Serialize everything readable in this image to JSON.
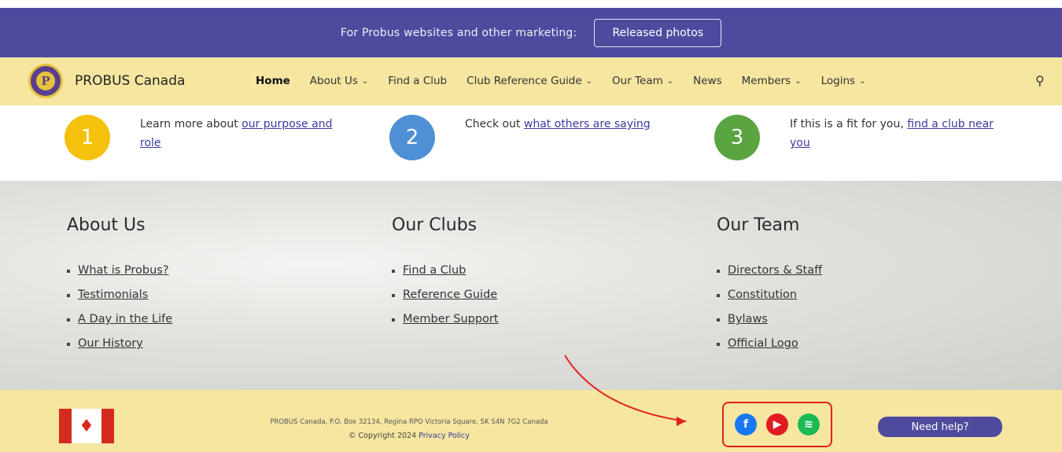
{
  "topbar": {
    "message": "For Probus websites and other marketing:",
    "button": "Released photos"
  },
  "brand": {
    "name": "PROBUS Canada",
    "logo_letter": "P"
  },
  "nav": [
    {
      "label": "Home",
      "active": true,
      "dropdown": false
    },
    {
      "label": "About Us",
      "dropdown": true
    },
    {
      "label": "Find a Club",
      "dropdown": false
    },
    {
      "label": "Club Reference Guide",
      "dropdown": true
    },
    {
      "label": "Our Team",
      "dropdown": true
    },
    {
      "label": "News",
      "dropdown": false
    },
    {
      "label": "Members",
      "dropdown": true
    },
    {
      "label": "Logins",
      "dropdown": true
    }
  ],
  "steps": [
    {
      "number": "1",
      "color": "#f4c20d",
      "text": "Learn more about ",
      "link": "our purpose and role"
    },
    {
      "number": "2",
      "color": "#4f8fd6",
      "text": "Check out ",
      "link": "what others are saying"
    },
    {
      "number": "3",
      "color": "#5aa541",
      "text": "If this is a fit for you, ",
      "link": "find a club near you"
    }
  ],
  "footer": {
    "columns": [
      {
        "title": "About Us",
        "links": [
          "What is Probus?",
          "Testimonials",
          "A Day in the Life",
          "Our History"
        ]
      },
      {
        "title": "Our Clubs",
        "links": [
          "Find a Club",
          "Reference Guide",
          "Member Support"
        ]
      },
      {
        "title": "Our Team",
        "links": [
          "Directors & Staff",
          "Constitution",
          "Bylaws",
          "Official Logo"
        ]
      }
    ],
    "address": "PROBUS Canada, P.O. Box 32134, Regina RPO Victoria Square, SK S4N 7G2 Canada",
    "copyright": "© Copyright 2024",
    "privacy": "Privacy Policy",
    "help": "Need help?",
    "social": [
      {
        "name": "facebook-icon",
        "color": "#1877f2",
        "glyph": "f"
      },
      {
        "name": "youtube-icon",
        "color": "#e01b22",
        "glyph": "▶"
      },
      {
        "name": "spotify-icon",
        "color": "#1db954",
        "glyph": "≋"
      }
    ]
  },
  "colors": {
    "purple": "#4e4a9e",
    "yellow": "#f6e6a0",
    "annotation": "#e3201f"
  }
}
